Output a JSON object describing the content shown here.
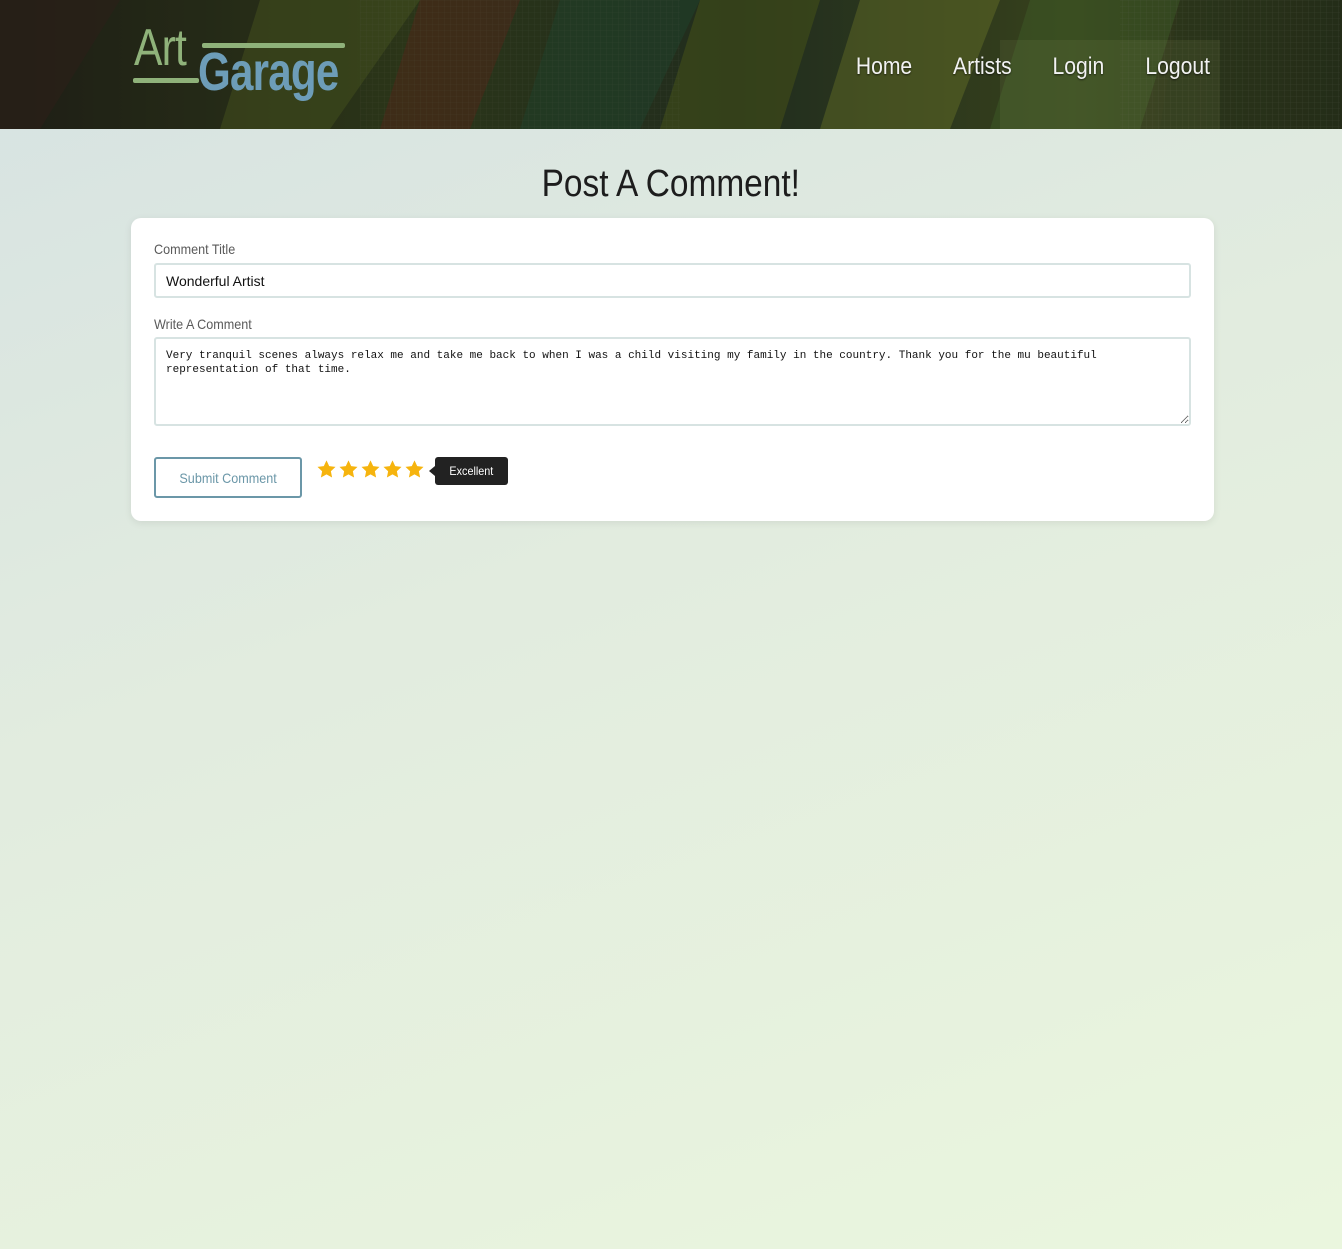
{
  "header": {
    "logo_part1": "Art",
    "logo_part2": "Garage",
    "nav": [
      {
        "label": "Home"
      },
      {
        "label": "Artists"
      },
      {
        "label": "Login"
      },
      {
        "label": "Logout"
      }
    ]
  },
  "page": {
    "title": "Post A Comment!"
  },
  "form": {
    "title_label": "Comment Title",
    "title_value": "Wonderful Artist",
    "comment_label": "Write A Comment",
    "comment_value": "Very tranquil scenes always relax me and take me back to when I was a child visiting my family in the country. Thank you for the mu beautiful representation of that time.",
    "submit_label": "Submit Comment",
    "rating": {
      "value": 5,
      "max": 5,
      "tooltip": "Excellent",
      "star_color": "#f6b40e",
      "icon": "star-icon"
    }
  },
  "colors": {
    "logo_green": "#8fb27a",
    "logo_blue": "#6d9db8",
    "button_accent": "#6b97a8"
  }
}
